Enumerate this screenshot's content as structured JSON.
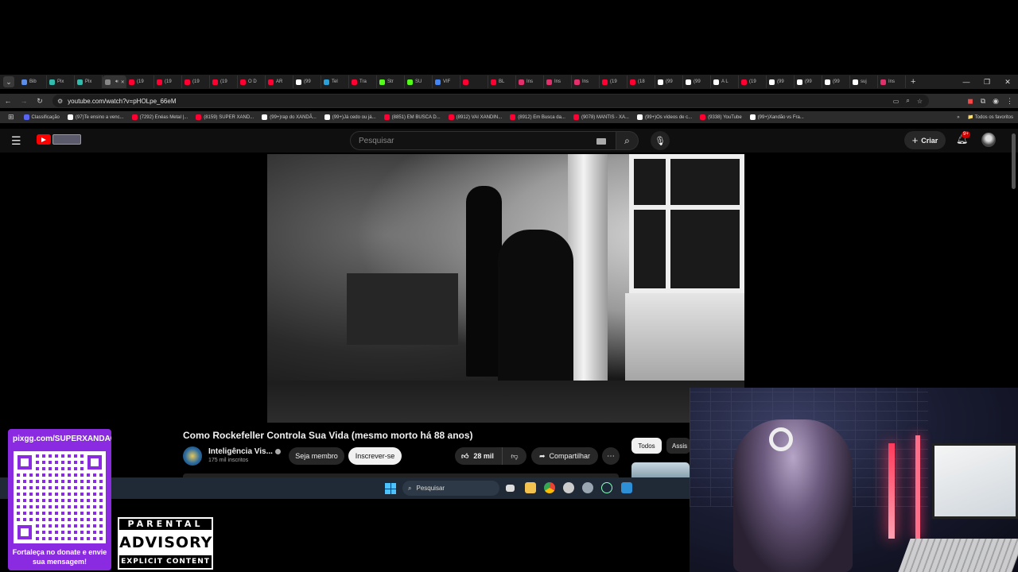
{
  "browser": {
    "tabs": [
      {
        "label": "Bib",
        "color": "#5b8def"
      },
      {
        "label": "Pix",
        "color": "#32bcad"
      },
      {
        "label": "Pix",
        "color": "#32bcad"
      },
      {
        "label": "",
        "color": "#888888",
        "active": true
      },
      {
        "label": "(19",
        "color": "#ff0033"
      },
      {
        "label": "(19",
        "color": "#ff0033"
      },
      {
        "label": "(19",
        "color": "#ff0033"
      },
      {
        "label": "(19",
        "color": "#ff0033"
      },
      {
        "label": "O D",
        "color": "#ff0033"
      },
      {
        "label": "AR",
        "color": "#ff0033"
      },
      {
        "label": "(99",
        "color": "#ffffff"
      },
      {
        "label": "Tel",
        "color": "#2aa1da"
      },
      {
        "label": "Tra",
        "color": "#ff0033"
      },
      {
        "label": "Str",
        "color": "#53fc18"
      },
      {
        "label": "SU",
        "color": "#53fc18"
      },
      {
        "label": "VIF",
        "color": "#4285f4"
      },
      {
        "label": "",
        "color": "#ff0033"
      },
      {
        "label": "BL",
        "color": "#ff0033"
      },
      {
        "label": "Ins",
        "color": "#e1306c"
      },
      {
        "label": "Ins",
        "color": "#e1306c"
      },
      {
        "label": "Ins",
        "color": "#e1306c"
      },
      {
        "label": "(19",
        "color": "#ff0033"
      },
      {
        "label": "(18",
        "color": "#ff0033"
      },
      {
        "label": "(99",
        "color": "#ffffff"
      },
      {
        "label": "(99",
        "color": "#ffffff"
      },
      {
        "label": "A L",
        "color": "#ffffff"
      },
      {
        "label": "(19",
        "color": "#ff0033"
      },
      {
        "label": "(99",
        "color": "#ffffff"
      },
      {
        "label": "(99",
        "color": "#ffffff"
      },
      {
        "label": "(99",
        "color": "#ffffff"
      },
      {
        "label": "suj",
        "color": "#ffffff"
      },
      {
        "label": "Ins",
        "color": "#e1306c"
      }
    ],
    "url": "youtube.com/watch?v=pHOLpe_66eM",
    "bookmarks": [
      {
        "label": "Classificação",
        "color": "#5865f2"
      },
      {
        "label": "(97)Te ensino a venc...",
        "color": "#ffffff"
      },
      {
        "label": "(7292) Enéas Metal |...",
        "color": "#ff0033"
      },
      {
        "label": "(8159) SUPER XAND...",
        "color": "#ff0033"
      },
      {
        "label": "(99+)rap do XANDÃ...",
        "color": "#ffffff"
      },
      {
        "label": "(99+)Já cedo ou já...",
        "color": "#ffffff"
      },
      {
        "label": "(8851) EM BUSCA D...",
        "color": "#ff0033"
      },
      {
        "label": "(8912) VAI XANDIN...",
        "color": "#ff0033"
      },
      {
        "label": "(8912) Em Busca da...",
        "color": "#ff0033"
      },
      {
        "label": "(9078) MANTIS - XA...",
        "color": "#ff0033"
      },
      {
        "label": "(99+)Os vídeos de c...",
        "color": "#ffffff"
      },
      {
        "label": "(9338) YouTube",
        "color": "#ff0033"
      },
      {
        "label": "(99+)Xandão vs Fra...",
        "color": "#ffffff"
      }
    ],
    "bookmarks_more": "»",
    "all_bookmarks": "Todos os favoritos"
  },
  "youtube": {
    "search_placeholder": "Pesquisar",
    "create_label": "Criar",
    "notification_count": "9+",
    "video": {
      "title": "Como Rockefeller Controla Sua Vida (mesmo morto há 88 anos)",
      "channel_name": "Inteligência Vis...",
      "subscribers": "175 mil inscritos",
      "member_label": "Seja membro",
      "subscribe_label": "Inscrever-se",
      "likes": "28 mil",
      "share_label": "Compartilhar"
    },
    "chips": [
      "Todos",
      "Assis"
    ]
  },
  "taskbar": {
    "search_placeholder": "Pesquisar"
  },
  "overlay": {
    "pix_url": "pixgg.com/SUPERXANDAO",
    "donate_caption": "Fortaleça no donate e envie sua mensagem!",
    "advisory_top": "PARENTAL",
    "advisory_mid": "ADVISORY",
    "advisory_bottom": "EXPLICIT CONTENT"
  }
}
